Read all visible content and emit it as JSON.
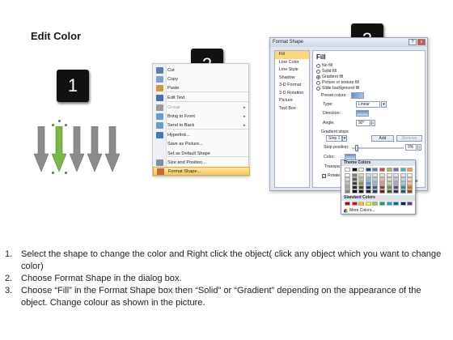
{
  "title": "Edit Color",
  "badges": [
    "1",
    "2",
    "3"
  ],
  "arrows": [
    {
      "color": "#8c8c8c"
    },
    {
      "color": "#7ab648",
      "selected": true
    },
    {
      "color": "#8c8c8c"
    },
    {
      "color": "#8c8c8c"
    },
    {
      "color": "#8c8c8c"
    }
  ],
  "context_menu": {
    "items": [
      {
        "label": "Cut",
        "icon": "scissors-icon"
      },
      {
        "label": "Copy",
        "icon": "copy-icon"
      },
      {
        "label": "Paste",
        "icon": "paste-icon"
      },
      {
        "label": "Edit Text",
        "icon": "edit-text-icon"
      },
      {
        "label": "Group",
        "icon": "group-icon",
        "disabled": true,
        "submenu": true
      },
      {
        "label": "Bring to Front",
        "icon": "bring-front-icon",
        "submenu": true
      },
      {
        "label": "Send to Back",
        "icon": "send-back-icon",
        "submenu": true
      },
      {
        "label": "Hyperlink...",
        "icon": "hyperlink-icon"
      },
      {
        "label": "Save as Picture...",
        "icon": ""
      },
      {
        "label": "Set as Default Shape",
        "icon": ""
      },
      {
        "label": "Size and Position...",
        "icon": "size-position-icon"
      },
      {
        "label": "Format Shape...",
        "icon": "format-shape-icon",
        "highlighted": true
      }
    ]
  },
  "dialog": {
    "title": "Format Shape",
    "buttons": {
      "minimize": "?",
      "close": "x"
    },
    "nav": [
      "Fill",
      "Line Color",
      "Line Style",
      "Shadow",
      "3-D Format",
      "3-D Rotation",
      "Picture",
      "Text Box"
    ],
    "pane": {
      "heading": "Fill",
      "options": [
        "No fill",
        "Solid fill",
        "Gradient fill",
        "Picture or texture fill",
        "Slide background fill"
      ],
      "selected_option": "Gradient fill",
      "preset_colors_label": "Preset colors:",
      "type_label": "Type:",
      "type_value": "Linear",
      "direction_label": "Direction:",
      "angle_label": "Angle:",
      "angle_value": "90°",
      "gradient_stops_label": "Gradient stops",
      "stop_value": "Stop 1",
      "add_label": "Add",
      "remove_label": "Remove",
      "stop_position_label": "Stop position:",
      "stop_position_value": "0%",
      "color_label": "Color:",
      "transparency_label": "Transpa",
      "rotate_label": "Rotate",
      "close_fragment": "se"
    }
  },
  "palette": {
    "theme_label": "Theme Colors",
    "standard_label": "Standard Colors",
    "more_label": "More Colors...",
    "theme_top": [
      "#ffffff",
      "#000000",
      "#eeece1",
      "#1f497d",
      "#4f81bd",
      "#c0504d",
      "#9bbb59",
      "#8064a2",
      "#4bacc6",
      "#f79646"
    ],
    "theme_shades": [
      [
        "#f2f2f2",
        "#7f7f7f",
        "#ddd9c3",
        "#c6d9f0",
        "#dbe5f1",
        "#f2dcdb",
        "#ebf1dd",
        "#e5e0ec",
        "#dbeef3",
        "#fdeada"
      ],
      [
        "#d8d8d8",
        "#595959",
        "#c4bd97",
        "#8db3e2",
        "#b8cce4",
        "#e5b9b7",
        "#d7e3bc",
        "#ccc1d9",
        "#b7dde8",
        "#fbd5b5"
      ],
      [
        "#bfbfbf",
        "#3f3f3f",
        "#938953",
        "#548dd4",
        "#95b3d7",
        "#d99694",
        "#c3d69b",
        "#b2a2c7",
        "#92cddc",
        "#fac08f"
      ],
      [
        "#a5a5a5",
        "#262626",
        "#494429",
        "#17365d",
        "#366092",
        "#953734",
        "#76923c",
        "#5f497a",
        "#31859b",
        "#e36c09"
      ],
      [
        "#7f7f7f",
        "#0c0c0c",
        "#1d1b10",
        "#0f243e",
        "#244061",
        "#632423",
        "#4f6128",
        "#3f3151",
        "#205867",
        "#974806"
      ]
    ],
    "standard": [
      "#c00000",
      "#ff0000",
      "#ffc000",
      "#ffff00",
      "#92d050",
      "#00b050",
      "#00b0f0",
      "#0070c0",
      "#002060",
      "#7030a0"
    ]
  },
  "steps": [
    {
      "num": "1.",
      "text": "Select the shape to change the color and Right click the object( click any object which you want to change color)"
    },
    {
      "num": "2.",
      "text": "Choose Format Shape in the dialog box."
    },
    {
      "num": "3.",
      "text": "Choose “Fill” in the Format Shape box then “Solid” or “Gradient” depending on the appearance of the object. Change colour as shown in the picture."
    }
  ]
}
